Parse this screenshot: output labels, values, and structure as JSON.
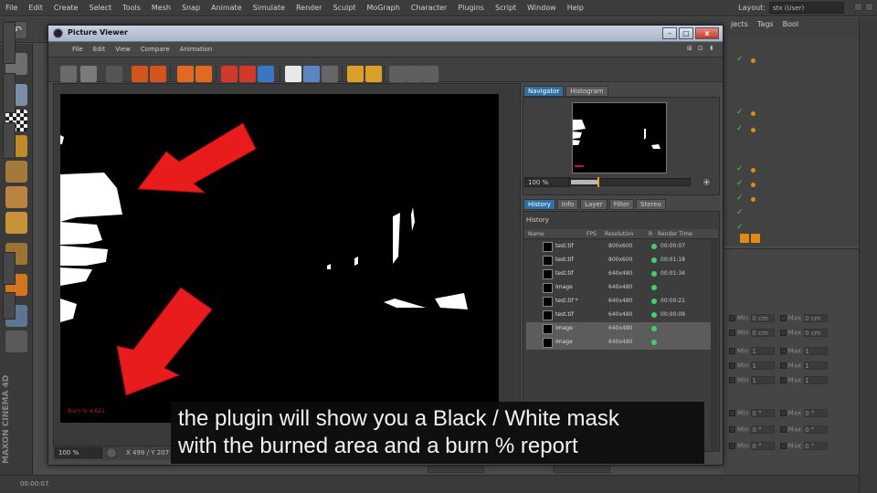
{
  "app": {
    "menu": [
      "File",
      "Edit",
      "Create",
      "Select",
      "Tools",
      "Mesh",
      "Snap",
      "Animate",
      "Simulate",
      "Render",
      "Sculpt",
      "MoGraph",
      "Character",
      "Plugins",
      "Script",
      "Window",
      "Help"
    ],
    "layout_label": "Layout:",
    "layout_value": "stx (User)",
    "object_tabs": [
      "jects",
      "Tags",
      "Bool"
    ],
    "logo": "MAXON CINEMA 4D",
    "timecode": "00:00:07",
    "attr_rows": [
      {
        "a": "Min",
        "av": "0 cm",
        "b": "Max",
        "bv": "0 cm"
      },
      {
        "a": "Min",
        "av": "0 cm",
        "b": "Max",
        "bv": "0 cm"
      },
      {
        "a": "Min",
        "av": "1",
        "b": "Max",
        "bv": "1"
      },
      {
        "a": "Min",
        "av": "1",
        "b": "Max",
        "bv": "1"
      },
      {
        "a": "Min",
        "av": "1",
        "b": "Max",
        "bv": "1"
      },
      {
        "a": "Min",
        "av": "0 °",
        "b": "Max",
        "bv": "0 °"
      },
      {
        "a": "Min",
        "av": "0 °",
        "b": "Max",
        "bv": "0 °"
      },
      {
        "a": "Min",
        "av": "0 °",
        "b": "Max",
        "bv": "0 °"
      }
    ]
  },
  "picture_viewer": {
    "title": "Picture Viewer",
    "menu": [
      "File",
      "Edit",
      "View",
      "Compare",
      "Animation"
    ],
    "close_glyph": "x",
    "burn_report": "Burn % 4.821",
    "zoom": "100 %",
    "coords": "X 499 / Y 207",
    "navigator": {
      "tabs": [
        "Navigator",
        "Histogram"
      ],
      "zoom": "100 %",
      "slider_level": 0.22
    },
    "history": {
      "tabs": [
        "History",
        "Info",
        "Layer",
        "Filter",
        "Stereo"
      ],
      "header": "History",
      "columns": [
        "Name",
        "FPS",
        "Resolution",
        "R",
        "Render Time"
      ],
      "rows": [
        {
          "name": "test.tif",
          "res": "800x600",
          "time": "00:00:07"
        },
        {
          "name": "test.tif",
          "res": "800x600",
          "time": "00:01:18"
        },
        {
          "name": "test.tif",
          "res": "640x480",
          "time": "00:01:34"
        },
        {
          "name": "Image",
          "res": "640x480",
          "time": ""
        },
        {
          "name": "test.tif *",
          "res": "640x480",
          "time": "00:00:21"
        },
        {
          "name": "test.tif",
          "res": "640x480",
          "time": "00:00:09"
        },
        {
          "name": "Image",
          "res": "640x480",
          "time": ""
        },
        {
          "name": "Image",
          "res": "640x480",
          "time": ""
        }
      ]
    }
  },
  "subtitle": {
    "line1": "the plugin will show you a Black / White mask",
    "line2": "with the burned area and a burn % report"
  },
  "colors": {
    "arrow_red": "#e81c1c",
    "accent_blue": "#2f6fa8",
    "status_green": "#3ed16a",
    "burn_text": "#c41818"
  }
}
